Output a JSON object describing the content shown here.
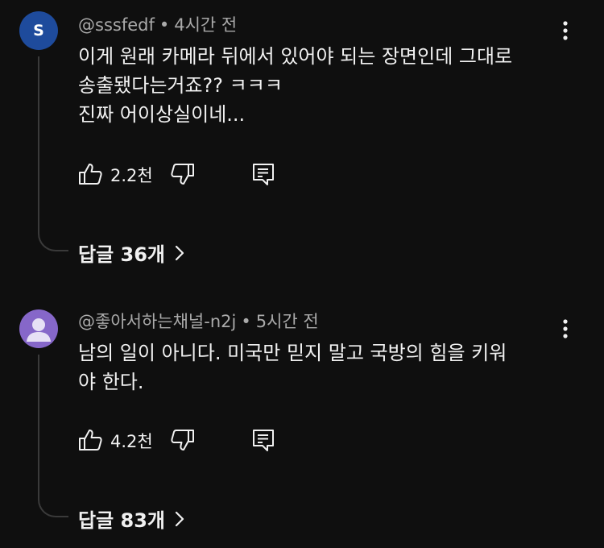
{
  "comments": [
    {
      "avatar_letter": "S",
      "avatar_color": "#1e4b9c",
      "author": "@sssfedf",
      "separator": "•",
      "time": "4시간 전",
      "text_lines": [
        "이게 원래 카메라 뒤에서 있어야 되는 장면인데 그대로",
        "송출됐다는거죠?? ㅋㅋㅋ",
        "진짜 어이상실이네..."
      ],
      "likes": "2.2천",
      "replies_label": "답글 36개"
    },
    {
      "avatar_icon": "person-icon",
      "avatar_color": "#8667c9",
      "author": "@좋아서하는채널-n2j",
      "separator": "•",
      "time": "5시간 전",
      "text_lines": [
        "남의 일이 아니다. 미국만 믿지 말고 국방의 힘을 키워",
        "야 한다."
      ],
      "likes": "4.2천",
      "replies_label": "답글 83개"
    }
  ]
}
